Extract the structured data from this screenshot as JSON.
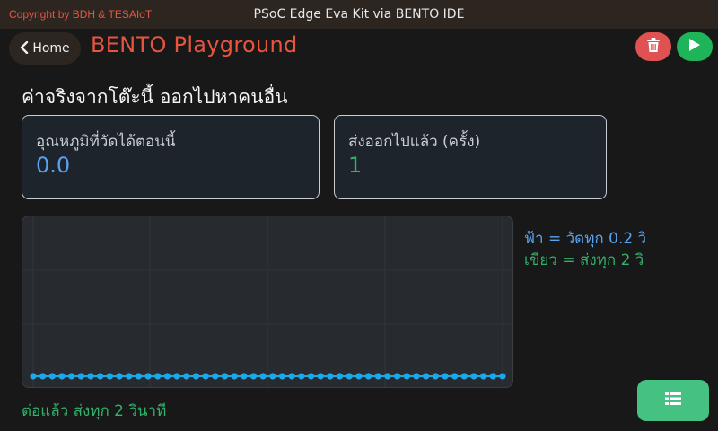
{
  "header": {
    "copyright": "Copyright by BDH & TESAIoT",
    "app_title": "PSoC Edge Eva Kit via BENTO IDE"
  },
  "nav": {
    "home_label": "Home",
    "page_title": "BENTO Playground",
    "delete_icon": "trash-icon",
    "run_icon": "play-icon"
  },
  "main": {
    "subtitle": "ค่าจริงจากโต๊ะนี้ ออกไปหาคนอื่น",
    "cards": [
      {
        "label": "อุณหภูมิที่วัดได้ตอนนี้",
        "value": "0.0"
      },
      {
        "label": "ส่งออกไปแล้ว (ครั้ง)",
        "value": "1"
      }
    ],
    "legend": {
      "blue": "ฟ้า = วัดทุก 0.2 วิ",
      "green": "เขียว = ส่งทุก 2 วิ"
    },
    "status": "ต่อแล้ว ส่งทุก 2 วินาที"
  },
  "colors": {
    "accent": "#e7553f",
    "blue": "#5aa2ee",
    "green": "#33b06a",
    "point": "#1aa8e8"
  },
  "chart_data": {
    "type": "line",
    "series": [
      {
        "values": [
          0,
          0,
          0,
          0,
          0,
          0,
          0,
          0,
          0,
          0,
          0,
          0,
          0,
          0,
          0,
          0,
          0,
          0,
          0,
          0,
          0,
          0,
          0,
          0,
          0,
          0,
          0,
          0,
          0,
          0,
          0,
          0,
          0,
          0,
          0,
          0,
          0,
          0,
          0,
          0,
          0,
          0,
          0,
          0,
          0,
          0,
          0,
          0,
          0,
          0
        ]
      }
    ],
    "ylim": [
      0,
      1
    ],
    "grid": true
  }
}
